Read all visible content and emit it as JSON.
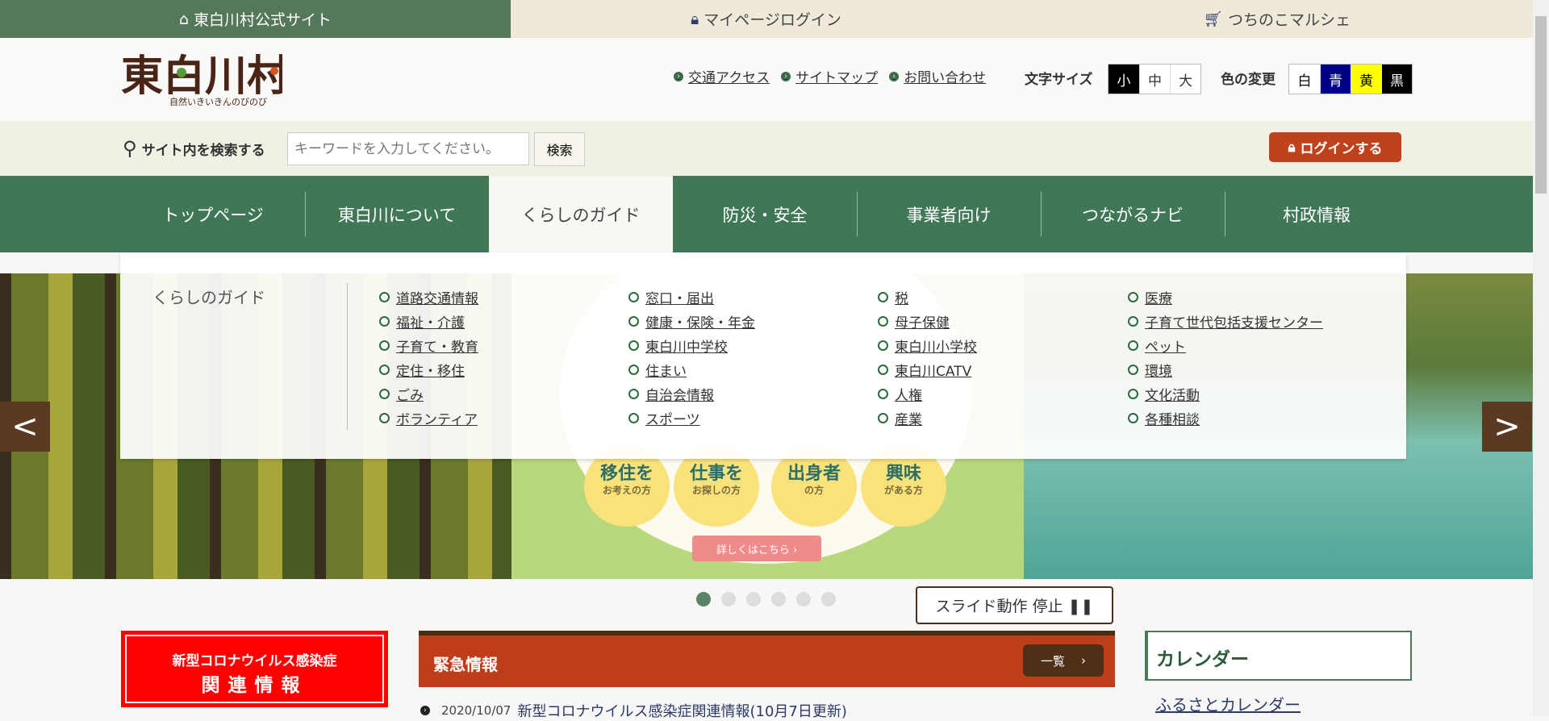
{
  "topbar": {
    "official": "東白川村公式サイト",
    "mypage": "マイページログイン",
    "shop": "つちのこマルシェ"
  },
  "logo": {
    "text": "東白川村",
    "tagline": "自然いきいきんのびのび"
  },
  "header": {
    "links": [
      "交通アクセス",
      "サイトマップ",
      "お問い合わせ"
    ],
    "font_size_label": "文字サイズ",
    "font_sizes": [
      "小",
      "中",
      "大"
    ],
    "color_label": "色の変更",
    "colors": [
      {
        "label": "白",
        "bg": "#ffffff",
        "fg": "#000000"
      },
      {
        "label": "青",
        "bg": "#000088",
        "fg": "#ffffff"
      },
      {
        "label": "黄",
        "bg": "#ffff00",
        "fg": "#000000"
      },
      {
        "label": "黒",
        "bg": "#000000",
        "fg": "#ffffff"
      }
    ]
  },
  "search": {
    "label": "サイト内を検索する",
    "placeholder": "キーワードを入力してください。",
    "button": "検索",
    "login": "ログインする"
  },
  "nav": [
    "トップページ",
    "東白川について",
    "くらしのガイド",
    "防災・安全",
    "事業者向け",
    "つながるナビ",
    "村政情報"
  ],
  "dropdown": {
    "title": "くらしのガイド",
    "columns": [
      [
        "道路交通情報",
        "福祉・介護",
        "子育て・教育",
        "定住・移住",
        "ごみ",
        "ボランティア"
      ],
      [
        "窓口・届出",
        "健康・保険・年金",
        "東白川中学校",
        "住まい",
        "自治会情報",
        "スポーツ"
      ],
      [
        "税",
        "母子保健",
        "東白川小学校",
        "東白川CATV",
        "人権",
        "産業"
      ],
      [
        "医療",
        "子育て世代包括支援センター",
        "ペット",
        "環境",
        "文化活動",
        "各種相談"
      ]
    ]
  },
  "banner": {
    "bubbles": [
      {
        "main": "移住を",
        "sub": "お考えの方"
      },
      {
        "main": "仕事を",
        "sub": "お探しの方"
      },
      {
        "main": "出身者",
        "sub": "の方"
      },
      {
        "main": "興味",
        "sub": "がある方"
      }
    ],
    "more": "詳しくはこちら ›"
  },
  "carousel": {
    "prev": "<",
    "next": ">",
    "pause": "スライド動作 停止 ❚❚"
  },
  "covid": {
    "line1": "新型コロナウイルス感染症",
    "line2": "関連情報"
  },
  "emergency": {
    "title": "緊急情報",
    "all": "一覧",
    "date": "2020/10/07",
    "headline": "新型コロナウイルス感染症関連情報(10月7日更新)"
  },
  "calendar": {
    "title": "カレンダー",
    "link": "ふるさとカレンダー"
  }
}
